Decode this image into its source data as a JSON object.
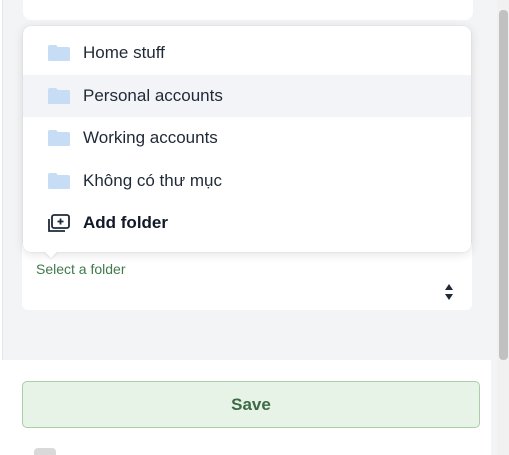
{
  "dropdown": {
    "options": [
      {
        "label": "Home stuff",
        "icon": "folder-icon",
        "highlighted": false
      },
      {
        "label": "Personal accounts",
        "icon": "folder-icon",
        "highlighted": true
      },
      {
        "label": "Working accounts",
        "icon": "folder-icon",
        "highlighted": false
      },
      {
        "label": "Không có thư mục",
        "icon": "folder-icon",
        "highlighted": false
      }
    ],
    "add_folder": {
      "label": "Add folder",
      "icon": "folder-plus-icon"
    }
  },
  "folder_select": {
    "placeholder": "Select a folder",
    "icon": "sort-arrows-icon"
  },
  "footer": {
    "save_label": "Save"
  },
  "colors": {
    "folder_icon": "#c7dcf5",
    "accent_green": "#3d6b45",
    "save_bg": "#e8f3e8",
    "highlight_row": "#f3f4f7"
  }
}
